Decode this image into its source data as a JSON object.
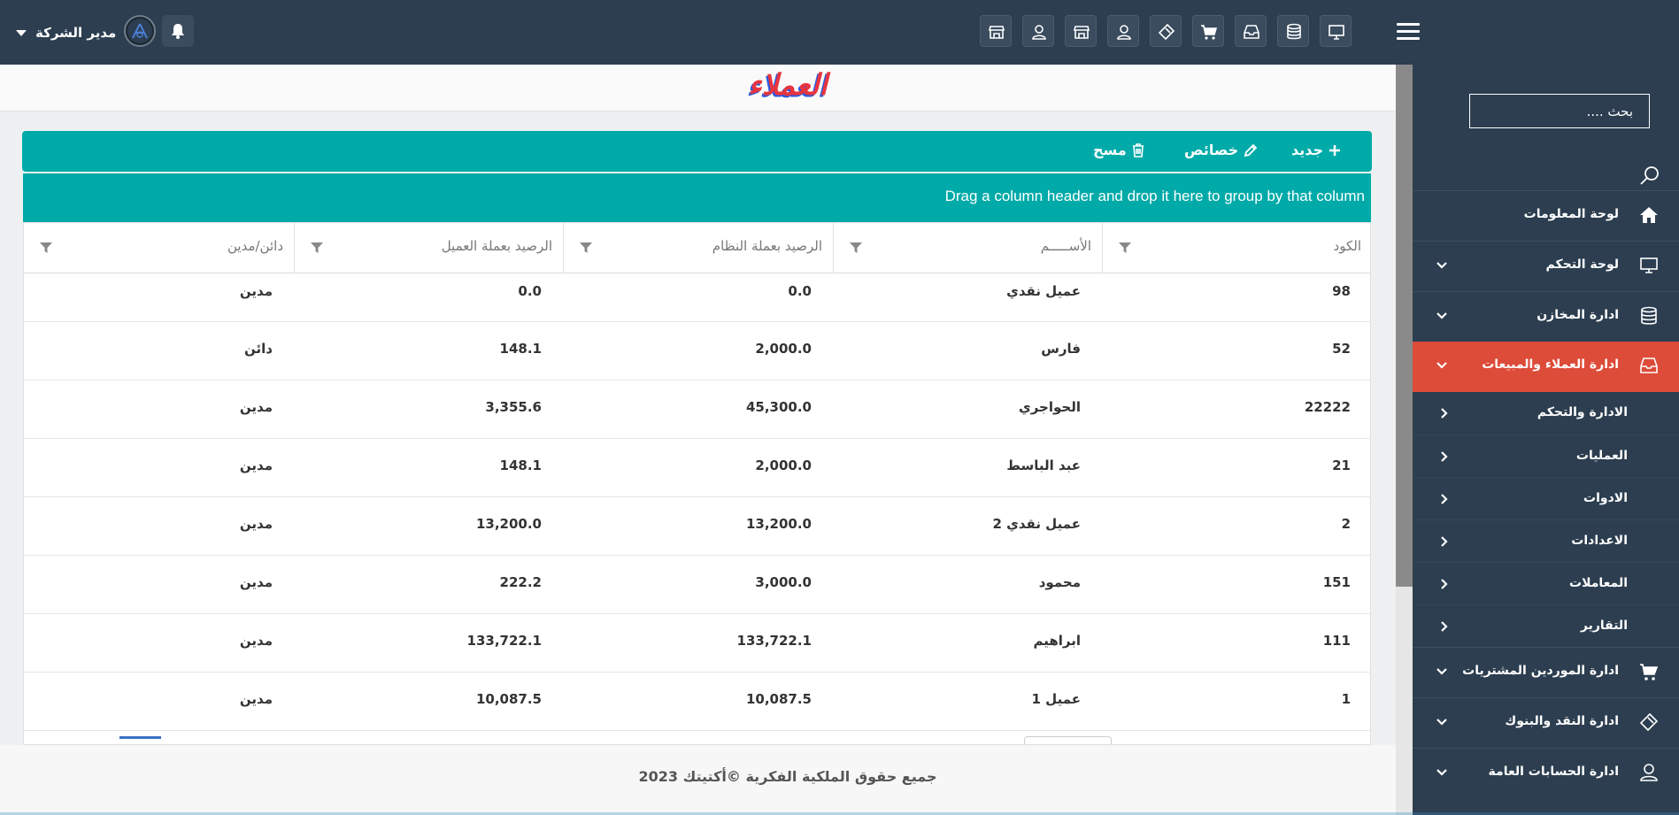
{
  "header": {
    "user_name": "مدير الشركة",
    "tool_icons": [
      "desktop-icon",
      "database-icon",
      "inbox-icon",
      "cart-icon",
      "ticket-icon",
      "user-icon",
      "store-icon",
      "user-icon",
      "store-icon"
    ]
  },
  "page": {
    "title": "العملاء"
  },
  "toolbar": {
    "new_label": "جديد",
    "props_label": "خصائص",
    "delete_label": "مسح"
  },
  "grid": {
    "group_hint": "Drag a column header and drop it here to group by that column",
    "columns": [
      "الكود",
      "الأســـــم",
      "الرصيد بعملة النظام",
      "الرصيد بعملة العميل",
      "دائن/مدين"
    ],
    "rows": [
      [
        "98",
        "عميل نقدي",
        "0.0",
        "0.0",
        "مدين"
      ],
      [
        "52",
        "فارس",
        "2,000.0",
        "148.1",
        "دائن"
      ],
      [
        "22222",
        "الحواجري",
        "45,300.0",
        "3,355.6",
        "مدين"
      ],
      [
        "21",
        "عبد الباسط",
        "2,000.0",
        "148.1",
        "مدين"
      ],
      [
        "2",
        "عميل نقدي 2",
        "13,200.0",
        "13,200.0",
        "مدين"
      ],
      [
        "151",
        "محمود",
        "3,000.0",
        "222.2",
        "مدين"
      ],
      [
        "111",
        "ابراهيم",
        "133,722.1",
        "133,722.1",
        "مدين"
      ],
      [
        "1",
        "عميل 1",
        "10,087.5",
        "10,087.5",
        "مدين"
      ]
    ]
  },
  "sidebar": {
    "search_placeholder": "بحث ....",
    "items": [
      {
        "label": "لوحة المعلومات",
        "icon": "home-icon"
      },
      {
        "label": "لوحة التحكم",
        "icon": "desktop-icon"
      },
      {
        "label": "ادارة المخازن",
        "icon": "database-icon"
      },
      {
        "label": "ادارة العملاء والمبيعات",
        "icon": "inbox-icon"
      },
      {
        "label": "ادارة الموردين المشتريات",
        "icon": "cart-icon"
      },
      {
        "label": "ادارة النقد والبنوك",
        "icon": "ticket-icon"
      },
      {
        "label": "ادارة الحسابات العامة",
        "icon": "user-icon"
      }
    ],
    "sub_items": [
      {
        "label": "الادارة والتحكم"
      },
      {
        "label": "العمليات"
      },
      {
        "label": "الادوات"
      },
      {
        "label": "الاعدادات"
      },
      {
        "label": "المعاملات"
      },
      {
        "label": "التقارير"
      }
    ]
  },
  "footer": {
    "text": "جميع حقوق الملكية الفكرية ©أكتيتك 2023"
  },
  "colors": {
    "topbar": "#2c3e50",
    "accent_teal": "#00aaa8",
    "active_red": "#dd4b39"
  }
}
